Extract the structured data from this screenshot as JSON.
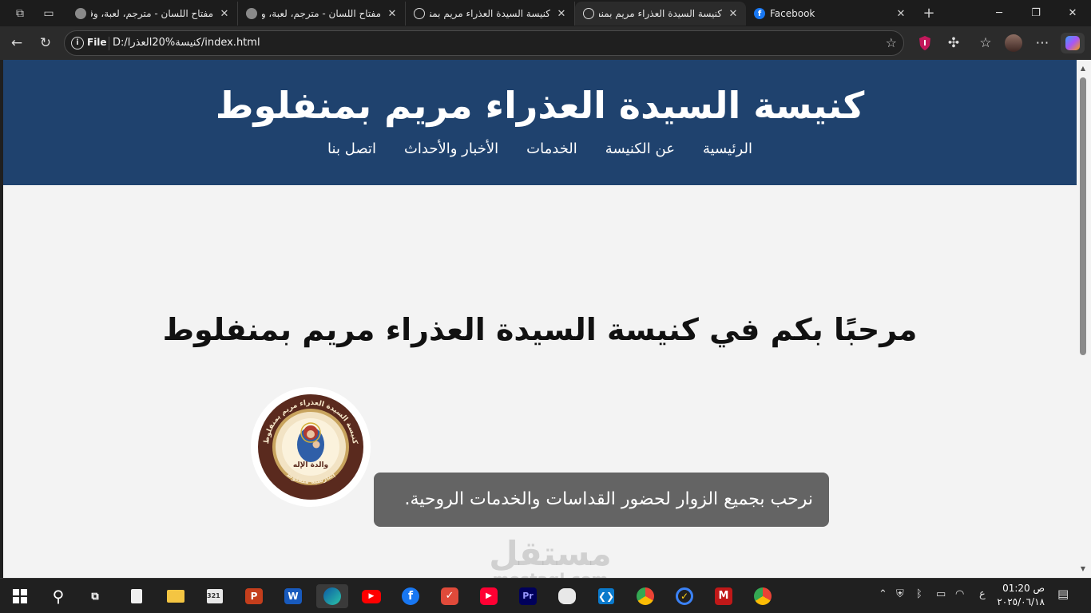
{
  "browser": {
    "tabs": [
      {
        "title": "مفتاح اللسان - مترجم، لعبة، وقا",
        "active": false
      },
      {
        "title": "مفتاح اللسان - مترجم، لعبة، وقا",
        "active": false
      },
      {
        "title": "كنيسة السيدة العذراء مريم بمنفلوط",
        "active": false
      },
      {
        "title": "كنيسة السيدة العذراء مريم بمنفلوط",
        "active": true
      },
      {
        "title": "Facebook",
        "active": false
      }
    ],
    "address": {
      "scheme": "File",
      "url": "D:/كنيسة%20العذرا/index.html"
    }
  },
  "page": {
    "header": {
      "title": "كنيسة السيدة العذراء مريم بمنفلوط",
      "nav": [
        "الرئيسية",
        "عن الكنيسة",
        "الخدمات",
        "الأخبار والأحداث",
        "اتصل بنا"
      ]
    },
    "welcome_heading": "مرحبًا بكم في كنيسة السيدة العذراء مريم بمنفلوط",
    "logo": {
      "ring_text": "كنيسة السيدة العذراء مريم بمنفلوط",
      "center_text": "والدة الإله",
      "bottom_text": "إيبارشية منفلوط"
    },
    "welcome_note": "نرحب بجميع الزوار لحضور القداسات والخدمات الروحية."
  },
  "watermark": {
    "arabic": "مستقل",
    "latin": "mostaql.com"
  },
  "taskbar": {
    "keyboard_lang": "ع",
    "time": "01:20 ص",
    "date": "٢٠٢٥/٠٦/١٨"
  },
  "colors": {
    "header_bg": "#1f426e",
    "note_bg": "#646464",
    "page_bg": "#f3f3f3"
  }
}
